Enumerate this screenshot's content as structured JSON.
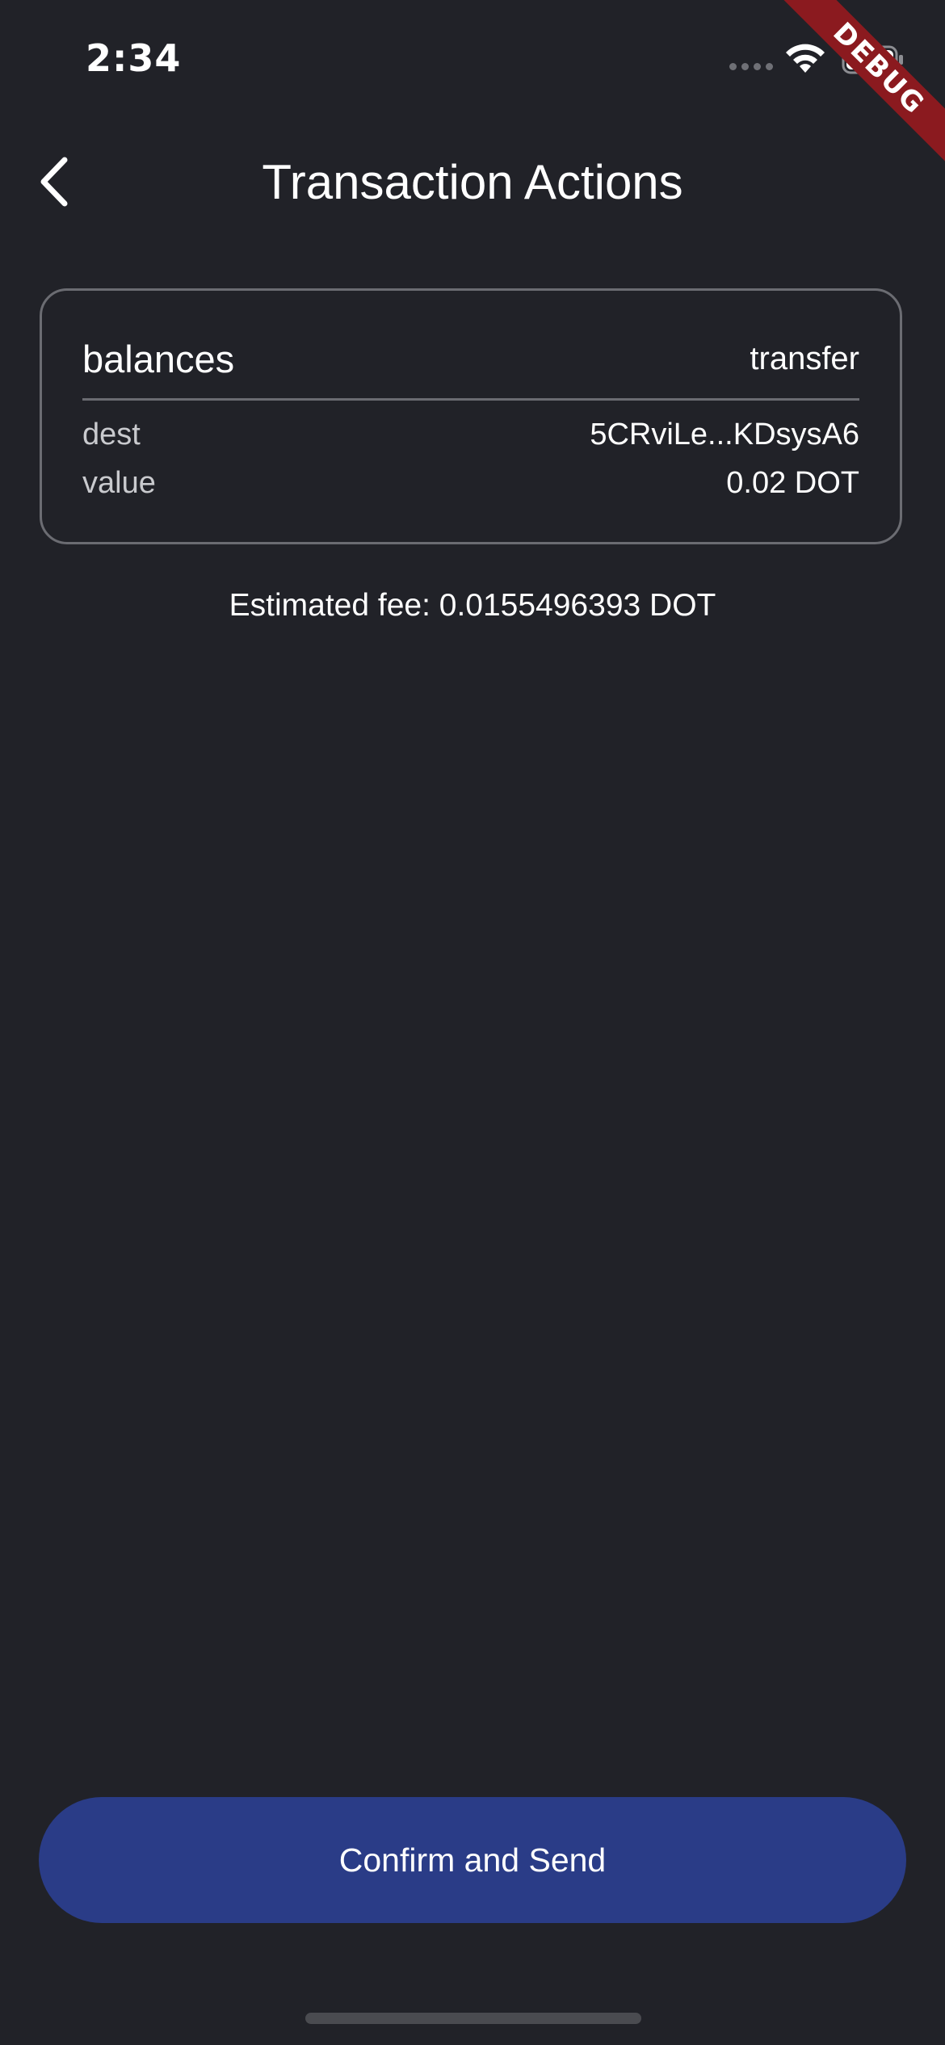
{
  "status_bar": {
    "time": "2:34"
  },
  "debug_banner": {
    "label": "DEBUG"
  },
  "header": {
    "back_icon": "chevron-left-icon",
    "title": "Transaction Actions"
  },
  "transaction": {
    "module": "balances",
    "call": "transfer",
    "args": [
      {
        "name": "dest",
        "value": "5CRviLe...KDsysA6"
      },
      {
        "name": "value",
        "value": "0.02 DOT"
      }
    ]
  },
  "fee": {
    "text": "Estimated fee: 0.0155496393 DOT"
  },
  "actions": {
    "confirm_label": "Confirm and Send"
  },
  "colors": {
    "background": "#212228",
    "button": "#2a3c87",
    "card_border": "#6b6c72",
    "debug_ribbon": "#8b1a1f"
  }
}
